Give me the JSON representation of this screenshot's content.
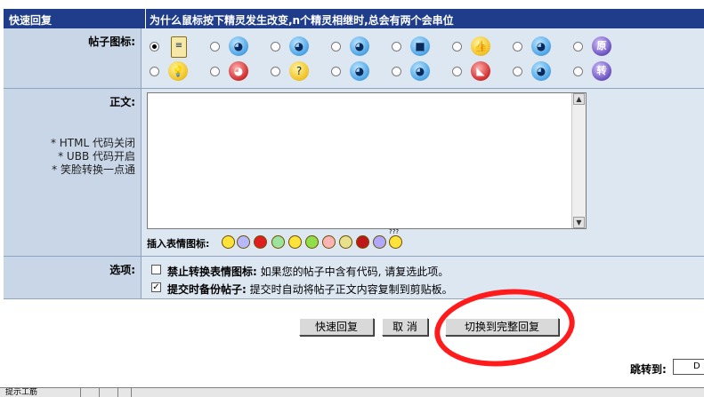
{
  "header": {
    "title": "快速回复",
    "note": "为什么鼠标按下精灵发生改变,n个精灵相继时,总会有两个会串位"
  },
  "post_icon": {
    "label": "帖子图标:",
    "icons": [
      {
        "name": "document-icon",
        "glyph": "≡"
      },
      {
        "name": "blue-ghost-1-icon",
        "glyph": "◕"
      },
      {
        "name": "blue-ghost-2-icon",
        "glyph": "◕"
      },
      {
        "name": "blue-ghost-3-icon",
        "glyph": "◕"
      },
      {
        "name": "sunglasses-icon",
        "glyph": "■"
      },
      {
        "name": "thumbs-up-icon",
        "glyph": "👍"
      },
      {
        "name": "blue-ghost-4-icon",
        "glyph": "◕"
      },
      {
        "name": "original-badge-icon",
        "glyph": "原"
      },
      {
        "name": "lightbulb-icon",
        "glyph": "💡"
      },
      {
        "name": "red-blue-ghost-icon",
        "glyph": "◕"
      },
      {
        "name": "question-icon",
        "glyph": "?"
      },
      {
        "name": "blue-ghost-5-icon",
        "glyph": "◕"
      },
      {
        "name": "blue-ghost-6-icon",
        "glyph": "◕"
      },
      {
        "name": "angry-red-icon",
        "glyph": "◣"
      },
      {
        "name": "blue-ghost-7-icon",
        "glyph": "◕"
      },
      {
        "name": "repost-badge-icon",
        "glyph": "转"
      }
    ]
  },
  "body": {
    "label": "正文:",
    "notes": [
      "* HTML 代码关闭",
      "* UBB 代码开启",
      "* 笑脸转换一点通"
    ],
    "textarea_value": "",
    "insert_label": "插入表情图标:",
    "smiley_question": "???"
  },
  "options": {
    "label": "选项:",
    "items": [
      {
        "title": "禁止转换表情图标:",
        "desc": "如果您的帖子中含有代码, 请复选此项。",
        "checked": false
      },
      {
        "title": "提交时备份帖子:",
        "desc": "提交时自动将帖子正文内容复制到剪贴板。",
        "checked": true
      }
    ]
  },
  "buttons": {
    "quick_reply": "快速回复",
    "cancel": "取 消",
    "full_reply": "切换到完整回复"
  },
  "jump": {
    "label": "跳转到:",
    "value": "D"
  },
  "taskbar": {
    "item1": "提示工筋"
  },
  "colors": {
    "header_bg": "#1f3d8a",
    "label_bg": "#c8d6e8",
    "content_bg": "#dde7f2",
    "annotation": "#ff1b1b"
  }
}
